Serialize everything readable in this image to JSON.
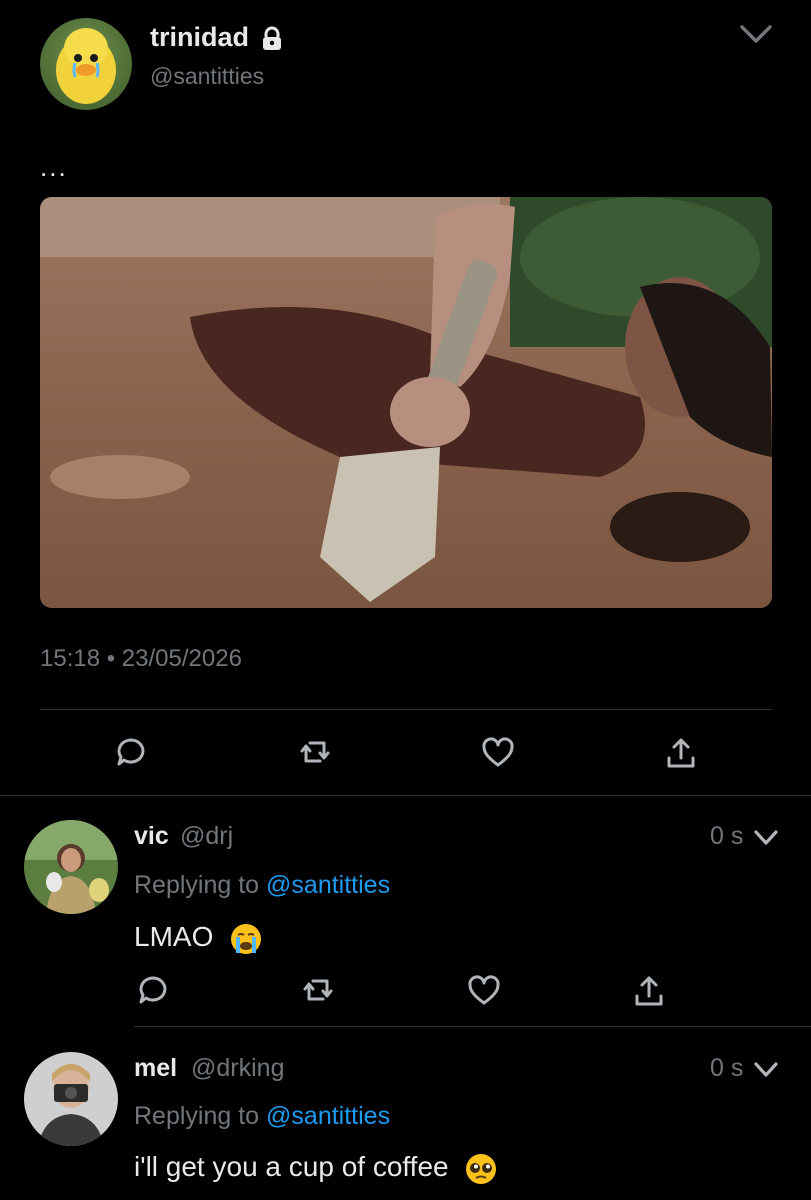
{
  "tweet": {
    "author": {
      "name": "trinidad",
      "handle": "@santitties",
      "locked": true,
      "avatar": "crying-duck-avatar"
    },
    "text": "...",
    "media": "photo-woman-buried-in-dirt-with-shovel",
    "timestamp": "15:18 • 23/05/2026",
    "actions": [
      "reply-icon",
      "retweet-icon",
      "like-icon",
      "share-icon"
    ]
  },
  "replies": [
    {
      "name": "vic",
      "handle": "@drj",
      "time": "0 s",
      "replying_label": "Replying to",
      "replying_to": "@santitties",
      "text": "LMAO",
      "emoji": "loudly-crying-face-emoji"
    },
    {
      "name": "mel",
      "handle": "@drking",
      "time": "0 s",
      "replying_label": "Replying to",
      "replying_to": "@santitties",
      "text": "i'll get you a cup of coffee",
      "emoji": "pleading-face-emoji"
    }
  ],
  "colors": {
    "background": "#000000",
    "text": "#e7e9ea",
    "secondary": "#71767b",
    "link": "#1d9bf0",
    "divider": "#2f3336"
  }
}
